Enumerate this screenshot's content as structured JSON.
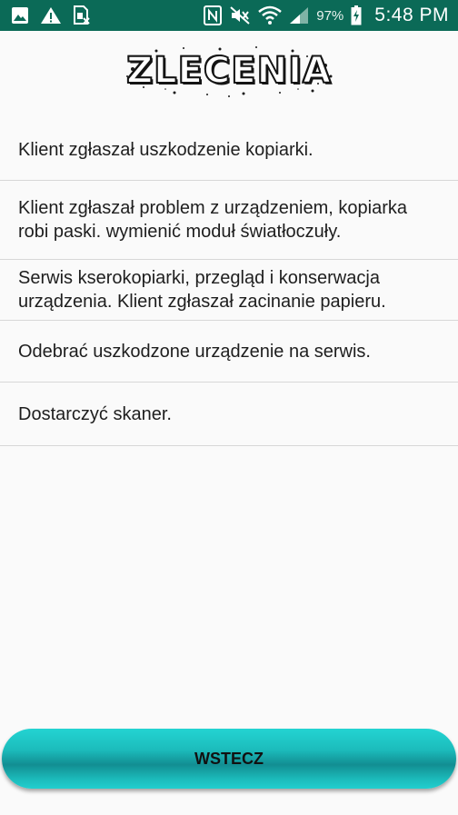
{
  "status_bar": {
    "battery_percent": "97%",
    "time": "5:48 PM",
    "icons_left": [
      "image-icon",
      "warning-icon",
      "sim-icon"
    ],
    "icons_right": [
      "nfc-icon",
      "mute-icon",
      "wifi-icon",
      "signal-icon",
      "battery-icon"
    ]
  },
  "header": {
    "logo_text": "ZLECENIA"
  },
  "orders": [
    {
      "text": "Klient zgłaszał uszkodzenie kopiarki."
    },
    {
      "text": "Klient zgłaszał problem z urządzeniem, kopiarka robi paski. wymienić moduł światłoczuły."
    },
    {
      "text": "Serwis kserokopiarki, przegląd i konserwacja urządzenia. Klient zgłaszał zacinanie papieru."
    },
    {
      "text": "Odebrać uszkodzone urządzenie na serwis."
    },
    {
      "text": "Dostarczyć skaner."
    }
  ],
  "footer": {
    "back_label": "WSTECZ"
  },
  "colors": {
    "status_bar": "#0b6a57",
    "button_teal": "#1cbcbc",
    "background": "#fafafa"
  }
}
